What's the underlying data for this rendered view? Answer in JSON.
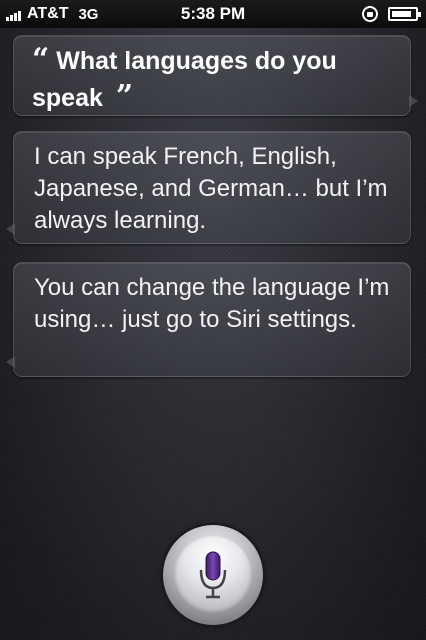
{
  "status_bar": {
    "carrier": "AT&T",
    "network": "3G",
    "time": "5:38 PM",
    "signal_bars": 4,
    "battery_level": 0.85,
    "icons": [
      "signal-bars-icon",
      "orientation-lock-icon",
      "battery-icon"
    ]
  },
  "conversation": {
    "user_query": {
      "open_quote": "“",
      "text": "What languages do you speak",
      "close_quote": "”"
    },
    "responses": [
      "I can speak French, English, Japanese, and German… but I’m always learning.",
      "You can change the language I’m using… just go to Siri settings."
    ]
  },
  "mic_button": {
    "icon": "microphone-icon",
    "accent": "#5b2d8e"
  }
}
